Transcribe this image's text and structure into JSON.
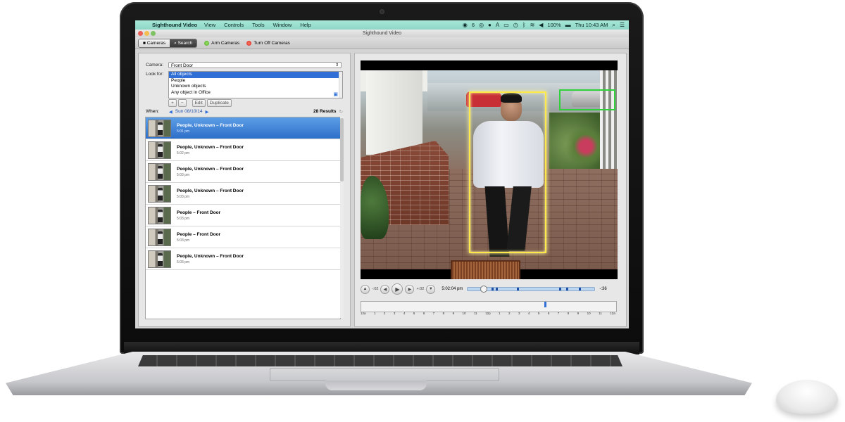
{
  "menubar": {
    "app_name": "Sighthound Video",
    "menus": [
      "View",
      "Controls",
      "Tools",
      "Window",
      "Help"
    ],
    "status_badge": "6",
    "battery": "100%",
    "clock": "Thu 10:43 AM"
  },
  "window": {
    "title": "Sighthound Video"
  },
  "toolbar": {
    "cameras_label": "Cameras",
    "search_label": "Search",
    "arm_label": "Arm Cameras",
    "turn_off_label": "Turn Off Cameras",
    "arm_color": "#4aa51f",
    "turn_off_color": "#d11f14"
  },
  "search": {
    "camera_label": "Camera:",
    "camera_value": "Front Door",
    "look_for_label": "Look for:",
    "look_for_options": [
      "All objects",
      "People",
      "Unknown objects",
      "Any object in Office"
    ],
    "add_label": "+",
    "remove_label": "−",
    "edit_label": "Edit",
    "duplicate_label": "Duplicate",
    "when_label": "When:",
    "date": "Sun 08/10/14",
    "results_count": "28 Results"
  },
  "results": [
    {
      "title": "People, Unknown –  Front Door",
      "time": "5:01 pm"
    },
    {
      "title": "People, Unknown –  Front Door",
      "time": "5:02 pm"
    },
    {
      "title": "People, Unknown –  Front Door",
      "time": "5:03 pm"
    },
    {
      "title": "People, Unknown –  Front Door",
      "time": "5:03 pm"
    },
    {
      "title": "People –  Front Door",
      "time": "5:03 pm"
    },
    {
      "title": "People –  Front Door",
      "time": "5:03 pm"
    },
    {
      "title": "People, Unknown –  Front Door",
      "time": "5:03 pm"
    }
  ],
  "playback": {
    "skip_back": "-:02",
    "skip_forward": "+:02",
    "current_time": "5:02:04 pm",
    "remaining": "-:36",
    "progress_fraction": 0.1
  },
  "timeline": {
    "ticks": [
      "12a",
      "1",
      "2",
      "3",
      "4",
      "5",
      "6",
      "7",
      "8",
      "9",
      "10",
      "11",
      "12p",
      "1",
      "2",
      "3",
      "4",
      "5",
      "6",
      "7",
      "8",
      "9",
      "10",
      "11",
      "12a"
    ]
  },
  "colors": {
    "menubar": "#a6e8d8",
    "selection": "#2f6fd6",
    "person_box": "#ffe84a",
    "car_box": "#30d13b"
  }
}
